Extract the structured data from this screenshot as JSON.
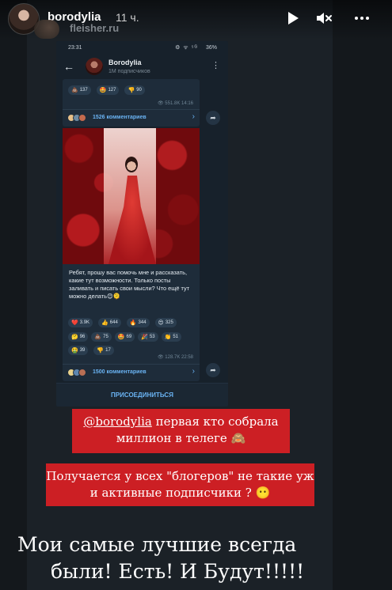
{
  "story": {
    "username": "borodylia",
    "time_ago": "11 ч.",
    "watermark": "fleisher.ru",
    "controls": {
      "play_icon": "play-icon",
      "mute_icon": "mute-icon",
      "more_icon": "more-icon"
    }
  },
  "telegram": {
    "status_time": "23:31",
    "status_icons": "⚙ ᯤ ⁵ᴳ",
    "battery": "36%",
    "channel_title": "Borodylia",
    "channel_subtitle": "1М подписчиков",
    "post1": {
      "reactions": [
        {
          "emoji": "💩",
          "count": "137"
        },
        {
          "emoji": "🤩",
          "count": "127"
        },
        {
          "emoji": "👎",
          "count": "90"
        }
      ],
      "meta": "👁 551.8K  14:16",
      "comments": "1526 комментариев"
    },
    "post2": {
      "text": "Ребят, прошу вас помочь мне и рассказать, какие тут возможности. Только посты заливать и писать свои мысли? Что ещё тут можно делать😊🫠",
      "reactions_row1": [
        {
          "emoji": "❤️",
          "count": "3.9K"
        },
        {
          "emoji": "👍",
          "count": "644"
        },
        {
          "emoji": "🔥",
          "count": "344"
        },
        {
          "emoji": "😍",
          "count": "325"
        }
      ],
      "reactions_row2": [
        {
          "emoji": "🤔",
          "count": "96"
        },
        {
          "emoji": "💩",
          "count": "75"
        },
        {
          "emoji": "🤩",
          "count": "69"
        },
        {
          "emoji": "🎉",
          "count": "53"
        },
        {
          "emoji": "👏",
          "count": "51"
        }
      ],
      "reactions_row3": [
        {
          "emoji": "🤮",
          "count": "39"
        },
        {
          "emoji": "👎",
          "count": "17"
        }
      ],
      "meta": "👁 128.7K  22:58",
      "comments": "1500 комментариев"
    },
    "join_label": "ПРИСОЕДИНИТЬСЯ"
  },
  "overlays": {
    "note1_mention": "@borodylia",
    "note1_text": " первая кто собрала миллион в телеге 🙈",
    "note2_text": "Получается у всех \"блогеров\" не такие уж и активные подписчики ? 😶",
    "caption_line1": "Мои самые лучшие всегда",
    "caption_line2": "были! Есть! И Будут!!!!!"
  }
}
